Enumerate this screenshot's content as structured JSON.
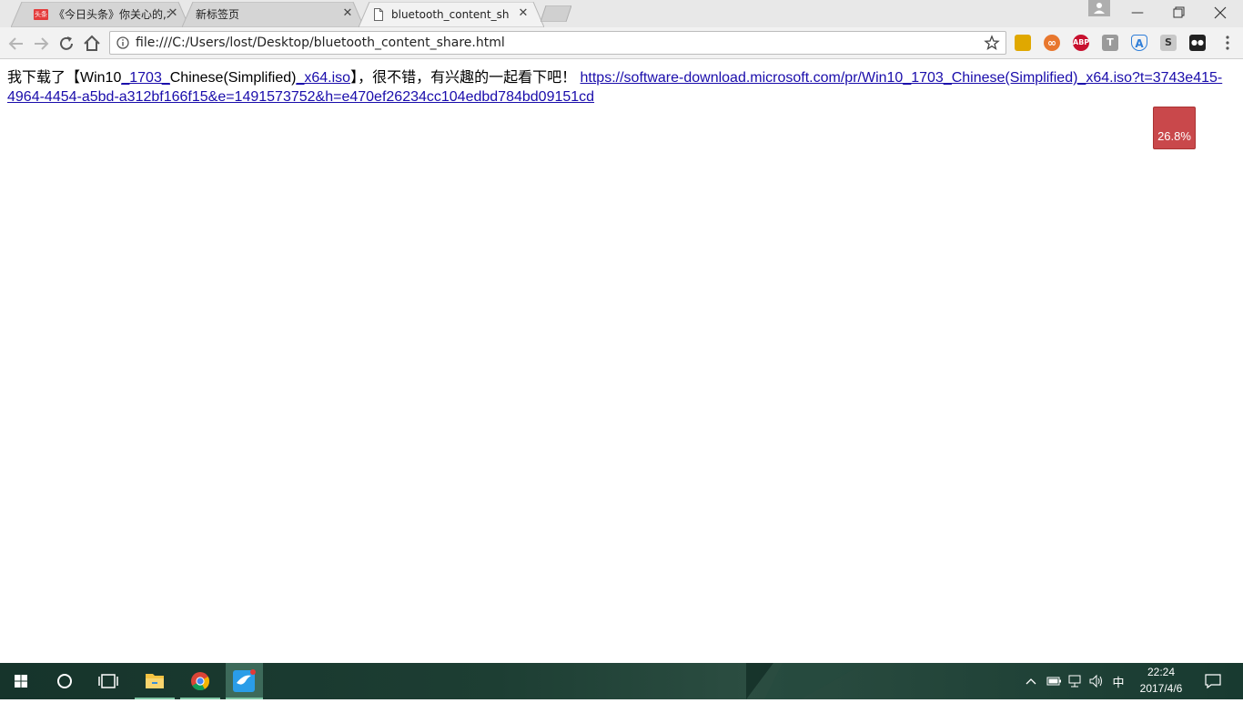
{
  "browser": {
    "tabs": [
      {
        "title": "《今日头条》你关心的,才",
        "favicon": "toutiao-favicon",
        "favicon_text": "头条",
        "active": false
      },
      {
        "title": "新标签页",
        "favicon": "none",
        "active": false
      },
      {
        "title": "bluetooth_content_sha",
        "favicon": "document-icon",
        "active": true
      }
    ],
    "address": "file:///C:/Users/lost/Desktop/bluetooth_content_share.html",
    "extensions": [
      {
        "name": "yellow-bird-extension-icon",
        "color": "#e0a800",
        "text": ""
      },
      {
        "name": "infinity-extension-icon",
        "color": "#e8772e",
        "text": "∞"
      },
      {
        "name": "adblock-plus-icon",
        "color": "#c8102e",
        "text": "ABP"
      },
      {
        "name": "t-extension-icon",
        "color": "#9a9a9a",
        "text": "T"
      },
      {
        "name": "shield-a-extension-icon",
        "color": "#2f7ed8",
        "text": "A"
      },
      {
        "name": "s-extension-icon",
        "color": "#c8c8c8",
        "text": "S"
      },
      {
        "name": "tampermonkey-icon",
        "color": "#222222",
        "text": "●●"
      }
    ]
  },
  "page": {
    "text_prefix": "我下载了【Win10",
    "text_u1": "_1703_",
    "text_mid": "Chinese(Simplified)",
    "text_u2": "_x64.iso",
    "text_suffix": "】，很不错，有兴趣的一起看下吧！ ",
    "link": "https://software-download.microsoft.com/pr/Win10_1703_Chinese(Simplified)_x64.iso?t=3743e415-4964-4454-a5bd-a312bf166f15&e=1491573752&h=e470ef26234cc104edbd784bd09151cd",
    "progress_label": "26.8%",
    "progress_value": 0.268,
    "progress_color": "#c9484b"
  },
  "taskbar": {
    "apps": [
      "start-icon",
      "cortana-icon",
      "task-view-icon",
      "file-explorer-icon",
      "chrome-icon",
      "bird-app-icon"
    ],
    "ime": "中",
    "time": "22:24",
    "date": "2017/4/6"
  }
}
